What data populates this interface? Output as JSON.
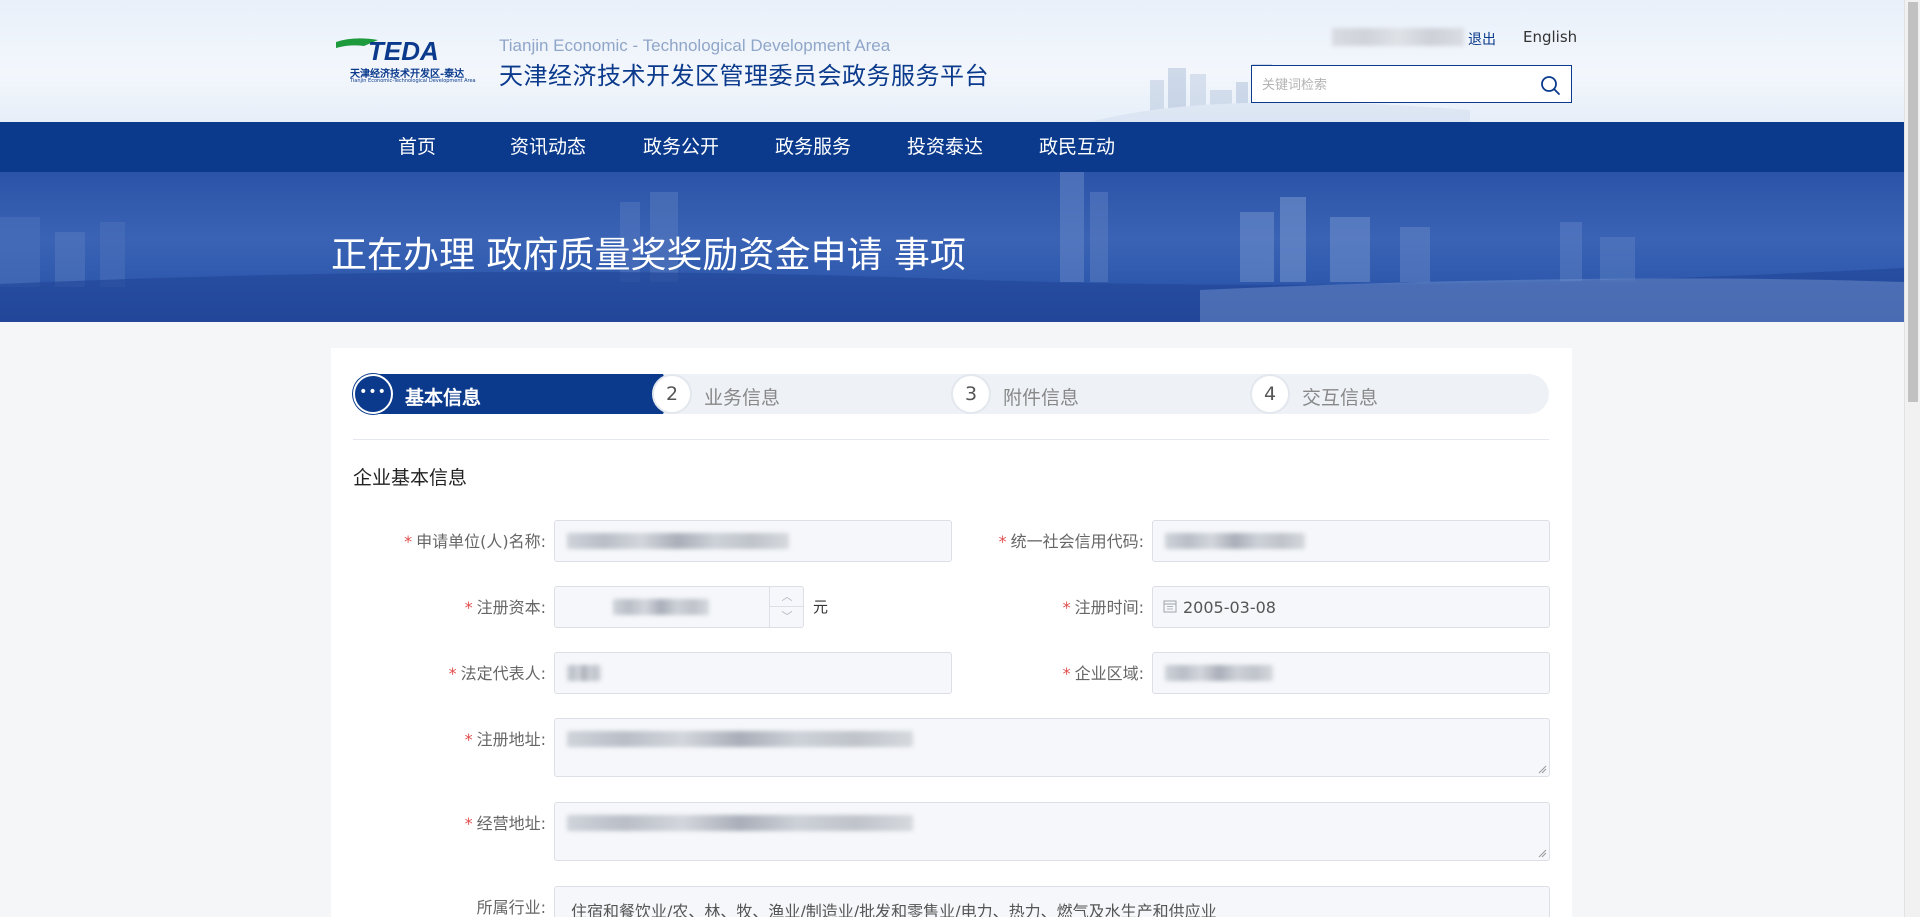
{
  "header": {
    "logo_text": "TEDA",
    "logo_sub_cn": "天津经济技术开发区-泰达",
    "logo_sub_en": "Tianjin Economic-Technological Development Area",
    "site_title_en": "Tianjin Economic - Technological Development Area",
    "site_title_cn": "天津经济技术开发区管理委员会政务服务平台",
    "logout_label": "退出",
    "language_label": "English",
    "search_placeholder": "关键词检索",
    "search_icon": "search-icon"
  },
  "nav": {
    "items": [
      "首页",
      "资讯动态",
      "政务公开",
      "政务服务",
      "投资泰达",
      "政民互动"
    ]
  },
  "banner": {
    "title": "正在办理 政府质量奖奖励资金申请 事项"
  },
  "steps": [
    {
      "number": "•••",
      "label": "基本信息",
      "active": true
    },
    {
      "number": "2",
      "label": "业务信息",
      "active": false
    },
    {
      "number": "3",
      "label": "附件信息",
      "active": false
    },
    {
      "number": "4",
      "label": "交互信息",
      "active": false
    }
  ],
  "form": {
    "section_title": "企业基本信息",
    "applicant_name": {
      "label": "申请单位(人)名称:",
      "required": true
    },
    "credit_code": {
      "label": "统一社会信用代码:",
      "required": true
    },
    "registered_capital": {
      "label": "注册资本:",
      "required": true,
      "unit": "元"
    },
    "registration_date": {
      "label": "注册时间:",
      "required": true,
      "value": "2005-03-08"
    },
    "legal_rep": {
      "label": "法定代表人:",
      "required": true
    },
    "region": {
      "label": "企业区域:",
      "required": true
    },
    "registered_address": {
      "label": "注册地址:",
      "required": true
    },
    "business_address": {
      "label": "经营地址:",
      "required": true
    },
    "industry": {
      "label": "所属行业:",
      "required": false,
      "value": "住宿和餐饮业/农、林、牧、渔业/制造业/批发和零售业/电力、热力、燃气及水生产和供应业"
    }
  },
  "colors": {
    "primary": "#0b3a8c",
    "required": "#e14b4b",
    "field_bg": "#f5f7fa"
  }
}
